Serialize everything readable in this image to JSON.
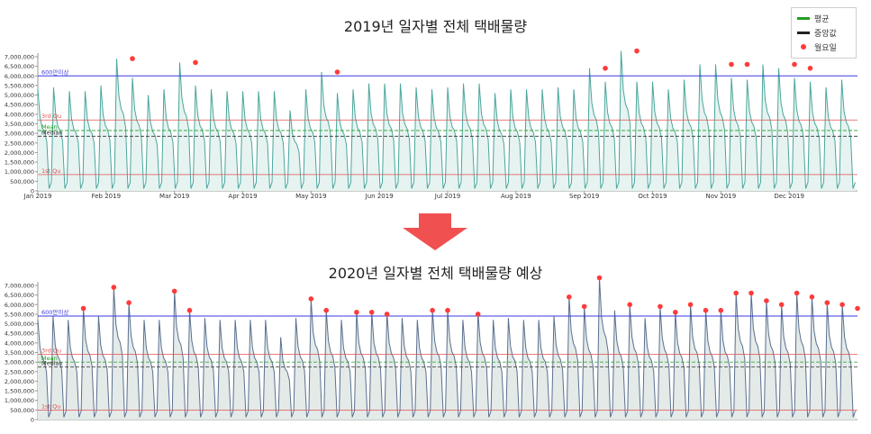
{
  "charts": [
    {
      "title": "2019년 일자별 전체 택배물량",
      "x_ticks": [
        "Jan 2019",
        "Feb 2019",
        "Mar 2019",
        "Apr 2019",
        "May 2019",
        "Jun 2019",
        "Jul 2019",
        "Aug 2019",
        "Sep 2019",
        "Oct 2019",
        "Nov 2019",
        "Dec 2019"
      ]
    },
    {
      "title": "2020년 일자별 전체 택배물량 예상",
      "x_ticks": []
    }
  ],
  "y_ticks": [
    "0",
    "500,000",
    "1,000,000",
    "1,500,000",
    "2,000,000",
    "2,500,000",
    "3,000,000",
    "3,500,000",
    "4,000,000",
    "4,500,000",
    "5,000,000",
    "5,500,000",
    "6,000,000",
    "6,500,000",
    "7,000,000"
  ],
  "ref_labels": {
    "threshold": "600만이상",
    "q3": "3rd Qu",
    "mean": "Mean",
    "median": "Median",
    "q1": "1st Qu"
  },
  "legend": {
    "mean": "평균",
    "median": "중앙값",
    "monday": "월요일"
  },
  "colors": {
    "line_2019": "#4aa69c",
    "fill_2019": "#e6f3f1",
    "line_2020": "#5a7090",
    "fill_2020": "#e3eae8",
    "threshold": "#3a3ae0",
    "quartile": "#e05050",
    "mean": "#20a020",
    "median": "#333333",
    "monday_dot": "#ff3b3b",
    "arrow": "#f05050"
  },
  "chart_data": [
    {
      "type": "line",
      "title": "2019년 일자별 전체 택배물량",
      "xlabel": "",
      "ylabel": "",
      "ylim": [
        0,
        7000000
      ],
      "x_range": [
        "2019-01-01",
        "2019-12-31"
      ],
      "reference_lines": {
        "threshold": 6000000,
        "q3": 3700000,
        "mean": 3150000,
        "median": 2850000,
        "q1": 850000
      },
      "weekly_mondays": [
        "2019-01-07",
        "2019-01-14",
        "2019-01-21",
        "2019-01-28",
        "2019-02-04",
        "2019-02-11",
        "2019-02-18",
        "2019-02-25",
        "2019-03-04",
        "2019-03-11",
        "2019-03-18",
        "2019-03-25",
        "2019-04-01",
        "2019-04-08",
        "2019-04-15",
        "2019-04-22",
        "2019-04-29",
        "2019-05-06",
        "2019-05-13",
        "2019-05-20",
        "2019-05-27",
        "2019-06-03",
        "2019-06-10",
        "2019-06-17",
        "2019-06-24",
        "2019-07-01",
        "2019-07-08",
        "2019-07-15",
        "2019-07-22",
        "2019-07-29",
        "2019-08-05",
        "2019-08-12",
        "2019-08-19",
        "2019-08-26",
        "2019-09-02",
        "2019-09-09",
        "2019-09-16",
        "2019-09-23",
        "2019-09-30",
        "2019-10-07",
        "2019-10-14",
        "2019-10-21",
        "2019-10-28",
        "2019-11-04",
        "2019-11-11",
        "2019-11-18",
        "2019-11-25",
        "2019-12-02",
        "2019-12-09",
        "2019-12-16",
        "2019-12-23",
        "2019-12-30"
      ],
      "weekly_peaks": [
        5300000,
        5400000,
        5200000,
        5200000,
        5500000,
        6900000,
        5900000,
        5000000,
        5300000,
        6700000,
        5500000,
        5300000,
        5200000,
        5200000,
        5200000,
        5200000,
        4200000,
        5300000,
        6200000,
        5100000,
        5300000,
        5600000,
        5600000,
        5600000,
        5400000,
        5300000,
        5400000,
        5600000,
        5600000,
        5100000,
        5300000,
        5300000,
        5300000,
        5400000,
        5300000,
        6400000,
        5700000,
        7300000,
        5700000,
        5700000,
        5300000,
        5800000,
        6600000,
        6600000,
        5900000,
        5800000,
        6600000,
        6400000,
        5900000,
        5700000,
        5400000,
        5800000
      ],
      "monday_markers": [
        {
          "x": "2019-02-11",
          "y": 6900000
        },
        {
          "x": "2019-03-11",
          "y": 6700000
        },
        {
          "x": "2019-05-13",
          "y": 6200000
        },
        {
          "x": "2019-09-09",
          "y": 6400000
        },
        {
          "x": "2019-09-23",
          "y": 7300000
        },
        {
          "x": "2019-11-04",
          "y": 6600000
        },
        {
          "x": "2019-11-11",
          "y": 6600000
        },
        {
          "x": "2019-12-02",
          "y": 6600000
        },
        {
          "x": "2019-12-09",
          "y": 6400000
        }
      ]
    },
    {
      "type": "line",
      "title": "2020년 일자별 전체 택배물량 예상",
      "xlabel": "",
      "ylabel": "",
      "ylim": [
        0,
        7000000
      ],
      "x_range": [
        "2020-01-01",
        "2020-12-31"
      ],
      "reference_lines": {
        "threshold": 5400000,
        "q3": 3400000,
        "mean": 3000000,
        "median": 2750000,
        "q1": 500000
      },
      "weekly_peaks": [
        5200000,
        5400000,
        5200000,
        5800000,
        5400000,
        6900000,
        6100000,
        5200000,
        5200000,
        6700000,
        5700000,
        5300000,
        5200000,
        5200000,
        5200000,
        5200000,
        4300000,
        5300000,
        6300000,
        5700000,
        5200000,
        5600000,
        5600000,
        5600000,
        5300000,
        5200000,
        5700000,
        5700000,
        5200000,
        5600000,
        5200000,
        5300000,
        5200000,
        5200000,
        5400000,
        6400000,
        5900000,
        7400000,
        5700000,
        6000000,
        5300000,
        5900000,
        5600000,
        6000000,
        5700000,
        5700000,
        6600000,
        6600000,
        6200000,
        6000000,
        6600000,
        6400000,
        6100000,
        6000000
      ],
      "monday_markers": [
        {
          "week": 4,
          "y": 5800000
        },
        {
          "week": 6,
          "y": 6900000
        },
        {
          "week": 7,
          "y": 6100000
        },
        {
          "week": 10,
          "y": 6700000
        },
        {
          "week": 11,
          "y": 5700000
        },
        {
          "week": 19,
          "y": 6300000
        },
        {
          "week": 20,
          "y": 5700000
        },
        {
          "week": 22,
          "y": 5600000
        },
        {
          "week": 23,
          "y": 5600000
        },
        {
          "week": 24,
          "y": 5500000
        },
        {
          "week": 27,
          "y": 5700000
        },
        {
          "week": 28,
          "y": 5700000
        },
        {
          "week": 30,
          "y": 5500000
        },
        {
          "week": 36,
          "y": 6400000
        },
        {
          "week": 37,
          "y": 5900000
        },
        {
          "week": 38,
          "y": 7400000
        },
        {
          "week": 40,
          "y": 6000000
        },
        {
          "week": 42,
          "y": 5900000
        },
        {
          "week": 43,
          "y": 5600000
        },
        {
          "week": 44,
          "y": 6000000
        },
        {
          "week": 45,
          "y": 5700000
        },
        {
          "week": 46,
          "y": 5700000
        },
        {
          "week": 47,
          "y": 6600000
        },
        {
          "week": 48,
          "y": 6600000
        },
        {
          "week": 49,
          "y": 6200000
        },
        {
          "week": 50,
          "y": 6000000
        },
        {
          "week": 51,
          "y": 6600000
        },
        {
          "week": 52,
          "y": 6400000
        },
        {
          "week": 53,
          "y": 6100000
        },
        {
          "week": 54,
          "y": 6000000
        },
        {
          "week": 55,
          "y": 5800000
        }
      ]
    }
  ]
}
